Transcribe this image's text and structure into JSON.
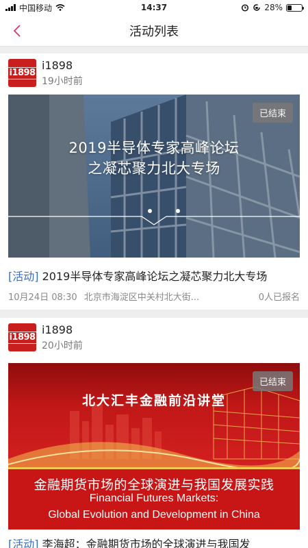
{
  "status_bar": {
    "carrier": "中国移动",
    "time": "14:37",
    "battery": "28%",
    "battery_level": 0.28
  },
  "nav": {
    "title": "活动列表"
  },
  "events": [
    {
      "author": "i1898",
      "avatar_text": "i1898",
      "time": "19小时前",
      "badge": "已结束",
      "banner_title_1": "2019半导体专家高峰论坛",
      "banner_title_2": "之凝芯聚力北大专场",
      "tag": "[活动]",
      "title": "2019半导体专家高峰论坛之凝芯聚力北大专场",
      "date": "10月24日 08:30",
      "location": "北京市海淀区中关村北大街...",
      "signup": "0人已报名"
    },
    {
      "author": "i1898",
      "avatar_text": "i1898",
      "time": "20小时前",
      "badge": "已结束",
      "banner_forum": "北大汇丰金融前沿讲堂",
      "banner_cn": "金融期货市场的全球演进与我国发展实践",
      "banner_en_1": "Financial Futures Markets:",
      "banner_en_2": "Global Evolution and Development in China",
      "tag": "[活动]",
      "title": "李海超：金融期货市场的全球演进与我国发"
    }
  ],
  "colors": {
    "accent": "#c81e1e",
    "tag": "#3a6dbf",
    "back": "#d0387a"
  },
  "icons": [
    "signal-icon",
    "wifi-icon",
    "alarm-icon",
    "rotation-lock-icon",
    "battery-icon",
    "back-arrow-icon"
  ]
}
